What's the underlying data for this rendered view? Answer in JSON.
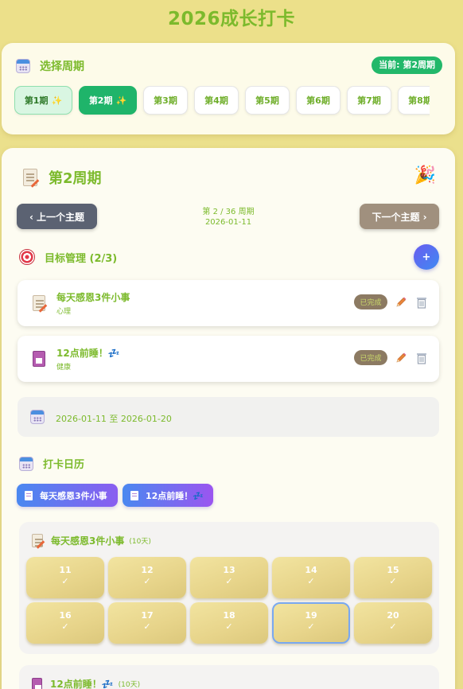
{
  "app": {
    "title": "2026成长打卡"
  },
  "period_selector": {
    "title": "选择周期",
    "current_badge": "当前: 第2周期",
    "periods": [
      {
        "label": "第1期",
        "spark": "✨"
      },
      {
        "label": "第2期",
        "spark": "✨"
      },
      {
        "label": "第3期"
      },
      {
        "label": "第4期"
      },
      {
        "label": "第5期"
      },
      {
        "label": "第6期"
      },
      {
        "label": "第7期"
      },
      {
        "label": "第8期"
      }
    ]
  },
  "period_detail": {
    "title": "第2周期",
    "party_icon": "🎉",
    "prev_label": "‹  上一个主题",
    "next_label": "下一个主题  ›",
    "week_counter": "第 2 / 36 周期",
    "week_date": "2026-01-11"
  },
  "goals": {
    "heading": "目标管理 (2/3)",
    "add_label": "+",
    "items": [
      {
        "name": "每天感恩3件小事",
        "category": "心理",
        "status": "已完成",
        "icon": "memo-icon"
      },
      {
        "name": "12点前睡！💤",
        "category": "健康",
        "status": "已完成",
        "icon": "floppy-icon"
      }
    ]
  },
  "date_range": {
    "text": "2026-01-11 至 2026-01-20"
  },
  "checkin_calendar": {
    "heading": "打卡日历",
    "filters": [
      "每天感恩3件小事",
      "12点前睡！💤"
    ],
    "sections": [
      {
        "name": "每天感恩3件小事",
        "days_label": "(10天)",
        "days": [
          {
            "day": "11",
            "mark": "✓"
          },
          {
            "day": "12",
            "mark": "✓"
          },
          {
            "day": "13",
            "mark": "✓"
          },
          {
            "day": "14",
            "mark": "✓"
          },
          {
            "day": "15",
            "mark": "✓"
          },
          {
            "day": "16",
            "mark": "✓"
          },
          {
            "day": "17",
            "mark": "✓"
          },
          {
            "day": "18",
            "mark": "✓"
          },
          {
            "day": "19",
            "mark": "✓"
          },
          {
            "day": "20",
            "mark": "✓"
          }
        ]
      },
      {
        "name": "12点前睡！💤",
        "days_label": "(10天)"
      }
    ]
  }
}
